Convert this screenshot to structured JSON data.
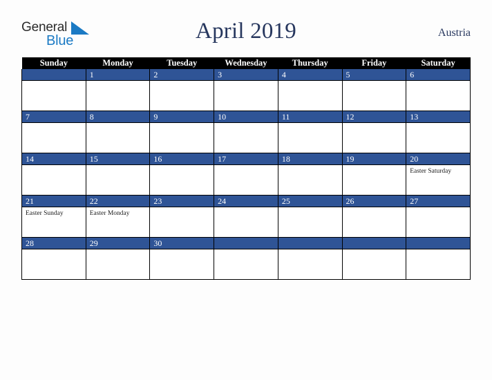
{
  "brand": {
    "name_top": "General",
    "name_bottom": "Blue",
    "top_color": "#2b2b2b",
    "bottom_color": "#1b7ac4",
    "triangle_color": "#1b7ac4"
  },
  "header": {
    "title": "April 2019",
    "country": "Austria",
    "title_color": "#27375e"
  },
  "theme": {
    "header_row_bg": "#000000",
    "header_row_text": "#ffffff",
    "date_bar_bg": "#2f5496",
    "date_bar_text": "#ffffff",
    "cell_bg": "#ffffff",
    "grid_line": "#000000",
    "page_bg": "#fdfdfd"
  },
  "weekday_headers": [
    "Sunday",
    "Monday",
    "Tuesday",
    "Wednesday",
    "Thursday",
    "Friday",
    "Saturday"
  ],
  "weeks": [
    [
      {
        "day": "",
        "events": []
      },
      {
        "day": "1",
        "events": []
      },
      {
        "day": "2",
        "events": []
      },
      {
        "day": "3",
        "events": []
      },
      {
        "day": "4",
        "events": []
      },
      {
        "day": "5",
        "events": []
      },
      {
        "day": "6",
        "events": []
      }
    ],
    [
      {
        "day": "7",
        "events": []
      },
      {
        "day": "8",
        "events": []
      },
      {
        "day": "9",
        "events": []
      },
      {
        "day": "10",
        "events": []
      },
      {
        "day": "11",
        "events": []
      },
      {
        "day": "12",
        "events": []
      },
      {
        "day": "13",
        "events": []
      }
    ],
    [
      {
        "day": "14",
        "events": []
      },
      {
        "day": "15",
        "events": []
      },
      {
        "day": "16",
        "events": []
      },
      {
        "day": "17",
        "events": []
      },
      {
        "day": "18",
        "events": []
      },
      {
        "day": "19",
        "events": []
      },
      {
        "day": "20",
        "events": [
          "Easter Saturday"
        ]
      }
    ],
    [
      {
        "day": "21",
        "events": [
          "Easter Sunday"
        ]
      },
      {
        "day": "22",
        "events": [
          "Easter Monday"
        ]
      },
      {
        "day": "23",
        "events": []
      },
      {
        "day": "24",
        "events": []
      },
      {
        "day": "25",
        "events": []
      },
      {
        "day": "26",
        "events": []
      },
      {
        "day": "27",
        "events": []
      }
    ],
    [
      {
        "day": "28",
        "events": []
      },
      {
        "day": "29",
        "events": []
      },
      {
        "day": "30",
        "events": []
      },
      {
        "day": "",
        "events": []
      },
      {
        "day": "",
        "events": []
      },
      {
        "day": "",
        "events": []
      },
      {
        "day": "",
        "events": []
      }
    ]
  ]
}
